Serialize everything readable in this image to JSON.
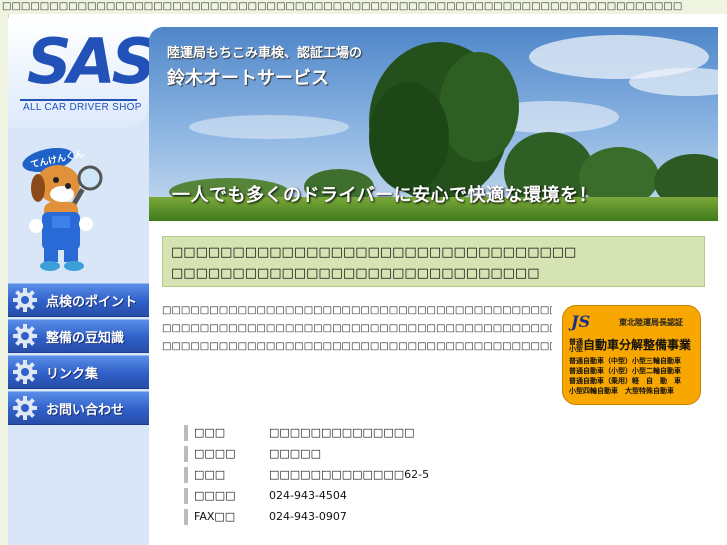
{
  "top_text": "□□□□□□□□□□□□□□□□□□□□□□□□□□□□□□□□□□□□□□□□□□□□□□□□□□□□□□□□□□□□□□□□□□□□□□□□",
  "logo": {
    "text": "SAS",
    "subtitle": "ALL CAR DRIVER SHOP",
    "color": "#2251b8"
  },
  "mascot": {
    "label": "てんけんくん"
  },
  "nav": [
    {
      "label": "点検のポイント",
      "icon": "gear-icon"
    },
    {
      "label": "整備の豆知識",
      "icon": "gear-icon"
    },
    {
      "label": "リンク集",
      "icon": "gear-icon"
    },
    {
      "label": "お問い合わせ",
      "icon": "gear-icon"
    }
  ],
  "hero": {
    "title1": "陸運局もちこみ車検、認証工場の",
    "title2": "鈴木オートサービス",
    "slogan": "一人でも多くのドライバーに安心で快適な環境を！"
  },
  "notice": {
    "line1": "□□□□□□□□□□□□□□□□□□□□□□□□□□□□□□□□□",
    "line2": "□□□□□□□□□□□□□□□□□□□□□□□□□□□□□□"
  },
  "intro": {
    "line1": "□□□□□□□□□□□□□□□□□□□□□□□□□□□□□□□□□□□□□□□□□□□□□□□□□□□□□□□",
    "line2": "□□□□□□□□□□□□□□□□□□□□□□□□□□□□□□□□□□□□□□□□□□□□□□□□□□□□□□□",
    "line3": "□□□□□□□□□□□□□□□□□□□□□□□□□□□□□□□□□□□□□□□□□□□□□□□"
  },
  "badge": {
    "mark": "JS",
    "authority": "東北陸運局長認証",
    "title": "自動車分解整備事業",
    "small": "普通\n小型",
    "types": "普通自動車（中型）小型三輪自動車\n普通自動車（小型）小型二輪自動車\n普通自動車（乗用）軽　自　動　車\n小型四輪自動車　大型特殊自動車"
  },
  "info": [
    {
      "key": "□□□",
      "value": "□□□□□□□□□□□□□□"
    },
    {
      "key": "□□□□",
      "value": "□□□□□"
    },
    {
      "key": "□□□",
      "value": "□□□□□□□□□□□□□62-5"
    },
    {
      "key": "□□□□",
      "value": "024-943-4504"
    },
    {
      "key": "FAX□□",
      "value": "024-943-0907"
    }
  ]
}
